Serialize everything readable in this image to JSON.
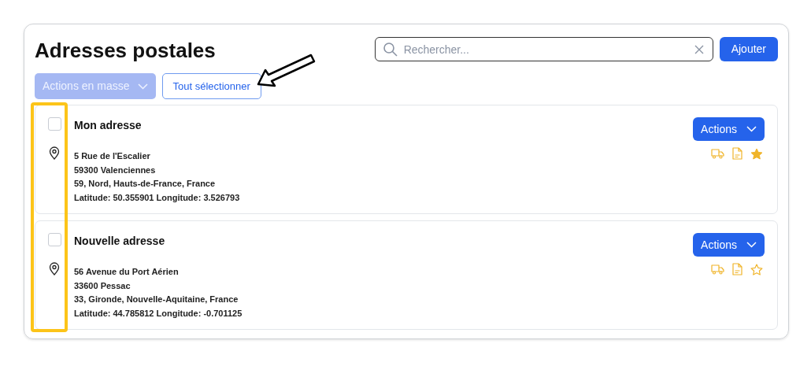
{
  "title": "Adresses postales",
  "search": {
    "placeholder": "Rechercher..."
  },
  "add_button": "Ajouter",
  "bulk_actions": {
    "label": "Actions en masse",
    "disabled": true
  },
  "select_all_button": "Tout sélectionner",
  "addresses": [
    {
      "name": "Mon adresse",
      "selected": false,
      "lines": [
        "5 Rue de l'Escalier",
        "59300 Valenciennes",
        "59, Nord, Hauts-de-France,  France",
        "Latitude: 50.355901 Longitude: 3.526793"
      ],
      "actions_label": "Actions",
      "favorite": true
    },
    {
      "name": "Nouvelle adresse",
      "selected": false,
      "lines": [
        "56 Avenue du Port Aérien",
        "33600 Pessac",
        "33, Gironde, Nouvelle-Aquitaine,  France",
        "Latitude: 44.785812 Longitude: -0.701125"
      ],
      "actions_label": "Actions",
      "favorite": false
    }
  ],
  "annotations": {
    "arrow": true,
    "highlight_frame": true
  }
}
